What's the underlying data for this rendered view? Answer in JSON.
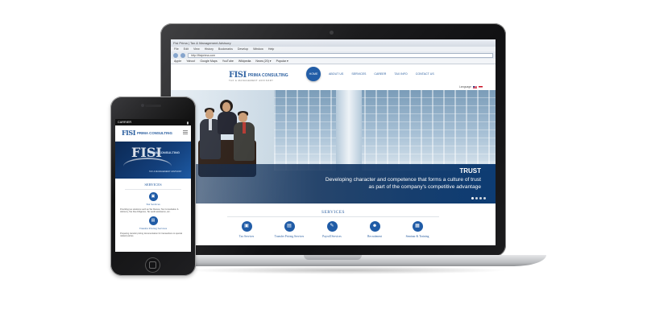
{
  "browser": {
    "window_title": "Fisi Prima | Tax & Management Advisory",
    "menu": [
      "File",
      "Edit",
      "View",
      "History",
      "Bookmarks",
      "Develop",
      "Window",
      "Help"
    ],
    "url": "http://fisiprima.com",
    "bookmarks": [
      "Apple",
      "Yahoo!",
      "Google Maps",
      "YouTube",
      "Wikipedia",
      "News (20) ▾",
      "Popular ▾"
    ]
  },
  "site": {
    "logo_mark": "FISI",
    "logo_text": "PRIMA CONSULTING",
    "logo_sub": "TAX & MANAGEMENT ADVISORY",
    "nav": [
      "HOME",
      "ABOUT US",
      "SERVICES",
      "CAREER",
      "TAX INFO",
      "CONTACT US"
    ],
    "language_label": "Language",
    "hero": {
      "title": "TRUST",
      "line1": "Developing character and competence that forms a culture of trust",
      "line2": "as part of the company's competitive advantage"
    },
    "services_title": "SERVICES",
    "services": [
      {
        "icon": "briefcase-icon",
        "label": "Tax Services"
      },
      {
        "icon": "document-icon",
        "label": "Transfer Pricing Services"
      },
      {
        "icon": "payroll-icon",
        "label": "Payroll Services"
      },
      {
        "icon": "people-icon",
        "label": "Recruitment"
      },
      {
        "icon": "training-icon",
        "label": "Seminar & Training"
      }
    ]
  },
  "phone": {
    "carrier": "CARRIER",
    "time": "",
    "hero_logo": "FISI",
    "hero_text": "PRIMA CONSULTING",
    "services_title": "SERVICES",
    "service1_label": "Tax Services",
    "service1_desc": "Providing tax solutions such as Tax Review, Tax Consultation & Advisory, Tax Due Diligence, Tax audit assistance, etc.",
    "service2_label": "Transfer Pricing Services",
    "service2_desc": "Preparing transfer pricing documentation for transactions to special related parties."
  },
  "colors": {
    "brand_blue": "#1f5ba6",
    "link_blue": "#2a5e9f",
    "hero_navy": "#0d3c73"
  }
}
